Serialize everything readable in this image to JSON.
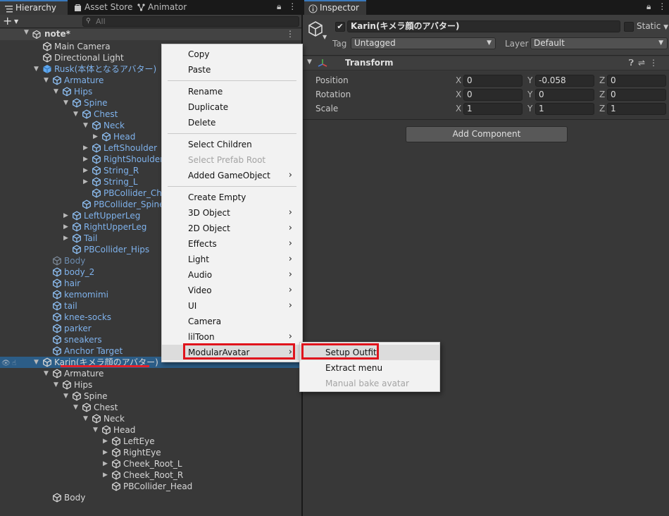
{
  "tabs": {
    "hierarchy": "Hierarchy",
    "asset_store": "Asset Store",
    "animator": "Animator",
    "inspector": "Inspector"
  },
  "hierarchy": {
    "plus_label": "+",
    "search_placeholder": "All",
    "scene_name": "note*",
    "rows": [
      {
        "label": "Main Camera",
        "depth": 1,
        "arrow": "",
        "style": "white",
        "icon": "cube-icon"
      },
      {
        "label": "Directional Light",
        "depth": 1,
        "arrow": "",
        "style": "white",
        "icon": "cube-icon"
      },
      {
        "label": "Rusk(本体となるアバター)",
        "depth": 1,
        "arrow": "down",
        "style": "blue",
        "icon": "prefab-icon"
      },
      {
        "label": "Armature",
        "depth": 2,
        "arrow": "down",
        "style": "blue",
        "icon": "cube-icon"
      },
      {
        "label": "Hips",
        "depth": 3,
        "arrow": "down",
        "style": "blue",
        "icon": "cube-icon"
      },
      {
        "label": "Spine",
        "depth": 4,
        "arrow": "down",
        "style": "blue",
        "icon": "cube-icon"
      },
      {
        "label": "Chest",
        "depth": 5,
        "arrow": "down",
        "style": "blue",
        "icon": "cube-icon"
      },
      {
        "label": "Neck",
        "depth": 6,
        "arrow": "down",
        "style": "blue",
        "icon": "cube-icon"
      },
      {
        "label": "Head",
        "depth": 7,
        "arrow": "right",
        "style": "blue",
        "icon": "cube-icon"
      },
      {
        "label": "LeftShoulder",
        "depth": 6,
        "arrow": "right",
        "style": "blue",
        "icon": "cube-icon"
      },
      {
        "label": "RightShoulder",
        "depth": 6,
        "arrow": "right",
        "style": "blue",
        "icon": "cube-icon"
      },
      {
        "label": "String_R",
        "depth": 6,
        "arrow": "right",
        "style": "blue",
        "icon": "cube-icon"
      },
      {
        "label": "String_L",
        "depth": 6,
        "arrow": "right",
        "style": "blue",
        "icon": "cube-icon"
      },
      {
        "label": "PBCollider_Che",
        "depth": 6,
        "arrow": "",
        "style": "blue",
        "icon": "cube-icon"
      },
      {
        "label": "PBCollider_Spine",
        "depth": 5,
        "arrow": "",
        "style": "blue",
        "icon": "cube-icon"
      },
      {
        "label": "LeftUpperLeg",
        "depth": 4,
        "arrow": "right",
        "style": "blue",
        "icon": "cube-icon"
      },
      {
        "label": "RightUpperLeg",
        "depth": 4,
        "arrow": "right",
        "style": "blue",
        "icon": "cube-icon"
      },
      {
        "label": "Tail",
        "depth": 4,
        "arrow": "right",
        "style": "blue",
        "icon": "cube-icon"
      },
      {
        "label": "PBCollider_Hips",
        "depth": 4,
        "arrow": "",
        "style": "blue",
        "icon": "cube-icon"
      },
      {
        "label": "Body",
        "depth": 2,
        "arrow": "",
        "style": "dim",
        "icon": "cube-icon"
      },
      {
        "label": "body_2",
        "depth": 2,
        "arrow": "",
        "style": "blue",
        "icon": "cube-icon"
      },
      {
        "label": "hair",
        "depth": 2,
        "arrow": "",
        "style": "blue",
        "icon": "cube-icon"
      },
      {
        "label": "kemomimi",
        "depth": 2,
        "arrow": "",
        "style": "blue",
        "icon": "cube-icon"
      },
      {
        "label": "tail",
        "depth": 2,
        "arrow": "",
        "style": "blue",
        "icon": "cube-icon"
      },
      {
        "label": "knee-socks",
        "depth": 2,
        "arrow": "",
        "style": "blue",
        "icon": "cube-icon"
      },
      {
        "label": "parker",
        "depth": 2,
        "arrow": "",
        "style": "blue",
        "icon": "cube-icon"
      },
      {
        "label": "sneakers",
        "depth": 2,
        "arrow": "",
        "style": "blue",
        "icon": "cube-icon"
      },
      {
        "label": "Anchor Target",
        "depth": 2,
        "arrow": "",
        "style": "blue",
        "icon": "cube-icon"
      },
      {
        "label": "Karin(キメラ顔のアバター)",
        "depth": 1,
        "arrow": "down",
        "style": "white",
        "icon": "cube-icon",
        "selected": true
      },
      {
        "label": "Armature",
        "depth": 2,
        "arrow": "down",
        "style": "white",
        "icon": "cube-icon"
      },
      {
        "label": "Hips",
        "depth": 3,
        "arrow": "down",
        "style": "white",
        "icon": "cube-icon"
      },
      {
        "label": "Spine",
        "depth": 4,
        "arrow": "down",
        "style": "white",
        "icon": "cube-icon"
      },
      {
        "label": "Chest",
        "depth": 5,
        "arrow": "down",
        "style": "white",
        "icon": "cube-icon"
      },
      {
        "label": "Neck",
        "depth": 6,
        "arrow": "down",
        "style": "white",
        "icon": "cube-icon"
      },
      {
        "label": "Head",
        "depth": 7,
        "arrow": "down",
        "style": "white",
        "icon": "cube-icon"
      },
      {
        "label": "LeftEye",
        "depth": 8,
        "arrow": "right",
        "style": "white",
        "icon": "cube-icon"
      },
      {
        "label": "RightEye",
        "depth": 8,
        "arrow": "right",
        "style": "white",
        "icon": "cube-icon"
      },
      {
        "label": "Cheek_Root_L",
        "depth": 8,
        "arrow": "right",
        "style": "white",
        "icon": "cube-icon"
      },
      {
        "label": "Cheek_Root_R",
        "depth": 8,
        "arrow": "right",
        "style": "white",
        "icon": "cube-icon"
      },
      {
        "label": "PBCollider_Head",
        "depth": 8,
        "arrow": "",
        "style": "white",
        "icon": "cube-icon"
      },
      {
        "label": "Body",
        "depth": 2,
        "arrow": "",
        "style": "white",
        "icon": "cube-icon"
      }
    ]
  },
  "inspector": {
    "object_name": "Karin(キメラ顔のアバター)",
    "static_label": "Static",
    "tag_label": "Tag",
    "tag_value": "Untagged",
    "layer_label": "Layer",
    "layer_value": "Default",
    "transform_title": "Transform",
    "position_label": "Position",
    "rotation_label": "Rotation",
    "scale_label": "Scale",
    "axis_x": "X",
    "axis_y": "Y",
    "axis_z": "Z",
    "position": {
      "x": "0",
      "y": "-0.058",
      "z": "0"
    },
    "rotation": {
      "x": "0",
      "y": "0",
      "z": "0"
    },
    "scale": {
      "x": "1",
      "y": "1",
      "z": "1"
    },
    "add_component": "Add Component"
  },
  "context_menu": {
    "items": [
      {
        "label": "Copy",
        "disabled": false,
        "submenu": false
      },
      {
        "label": "Paste",
        "disabled": false,
        "submenu": false
      },
      {
        "sep": true
      },
      {
        "label": "Rename",
        "disabled": false,
        "submenu": false
      },
      {
        "label": "Duplicate",
        "disabled": false,
        "submenu": false
      },
      {
        "label": "Delete",
        "disabled": false,
        "submenu": false
      },
      {
        "sep": true
      },
      {
        "label": "Select Children",
        "disabled": false,
        "submenu": false
      },
      {
        "label": "Select Prefab Root",
        "disabled": true,
        "submenu": false
      },
      {
        "label": "Added GameObject",
        "disabled": false,
        "submenu": true
      },
      {
        "sep": true
      },
      {
        "label": "Create Empty",
        "disabled": false,
        "submenu": false
      },
      {
        "label": "3D Object",
        "disabled": false,
        "submenu": true
      },
      {
        "label": "2D Object",
        "disabled": false,
        "submenu": true
      },
      {
        "label": "Effects",
        "disabled": false,
        "submenu": true
      },
      {
        "label": "Light",
        "disabled": false,
        "submenu": true
      },
      {
        "label": "Audio",
        "disabled": false,
        "submenu": true
      },
      {
        "label": "Video",
        "disabled": false,
        "submenu": true
      },
      {
        "label": "UI",
        "disabled": false,
        "submenu": true
      },
      {
        "label": "Camera",
        "disabled": false,
        "submenu": false
      },
      {
        "label": "lilToon",
        "disabled": false,
        "submenu": true
      },
      {
        "label": "ModularAvatar",
        "disabled": false,
        "submenu": true,
        "highlighted": true
      }
    ],
    "submenu_arrow": "›"
  },
  "modular_avatar_menu": {
    "items": [
      {
        "label": "Setup Outfit",
        "disabled": false,
        "highlighted": true
      },
      {
        "label": "Extract menu",
        "disabled": false
      },
      {
        "label": "Manual bake avatar",
        "disabled": true
      }
    ]
  },
  "colors": {
    "highlight_box": "#e0141c",
    "selection": "#2c5d87",
    "prefab_blue": "#7fb2ec"
  }
}
